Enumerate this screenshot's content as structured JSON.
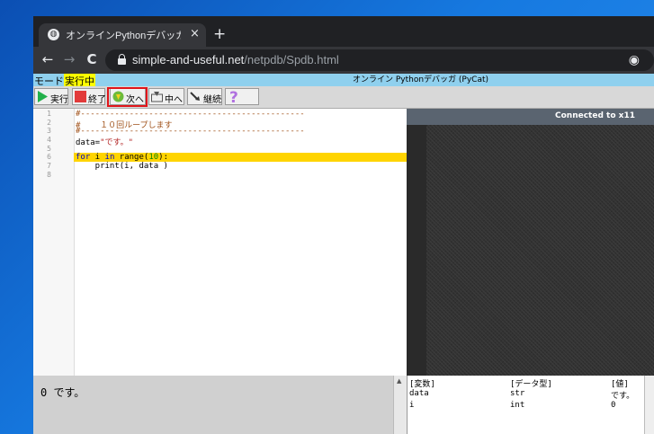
{
  "browser": {
    "tab_title": "オンラインPythonデバッガ [PyCat] (C",
    "tab_close": "×",
    "new_tab": "+",
    "url_host": "simple-and-useful.net",
    "url_path": "/netpdb/Spdb.html",
    "back": "←",
    "forward": "→",
    "reload": "C",
    "eye": "◉"
  },
  "modebar": {
    "mode_label": "モード",
    "mode_value": "実行中",
    "page_title": "オンライン Pythonデバッガ (PyCat)"
  },
  "toolbar": {
    "run": "実行",
    "stop": "終了",
    "next": "次へ",
    "step_in": "中へ",
    "continue": "継続"
  },
  "editor": {
    "line_numbers": [
      "1",
      "2",
      "3",
      "4",
      "5",
      "6",
      "7",
      "8"
    ],
    "lines": {
      "l1": "#----------------------------------------------",
      "l2a": "#",
      "l2b": "    １０回ループします",
      "l3": "#----------------------------------------------",
      "l4a": "data=",
      "l4b": "\"です。\"",
      "l6_for": "for",
      "l6_i": " i ",
      "l6_in": "in",
      "l6_range": " range(",
      "l6_num": "10",
      "l6_end": "):",
      "l7": "    print(i, data )"
    },
    "current_line": 6
  },
  "remote": {
    "title": "Connected to x11"
  },
  "output": {
    "text": "0 です。"
  },
  "variables": {
    "headers": [
      "[変数]",
      "[データ型]",
      "[値]"
    ],
    "rows": [
      [
        "data",
        "str",
        "です。"
      ],
      [
        "i",
        "int",
        "0"
      ]
    ]
  },
  "colors": {
    "highlight": "#e0141a",
    "current_line": "#ffd400",
    "mode_value_bg": "#ffff00"
  }
}
